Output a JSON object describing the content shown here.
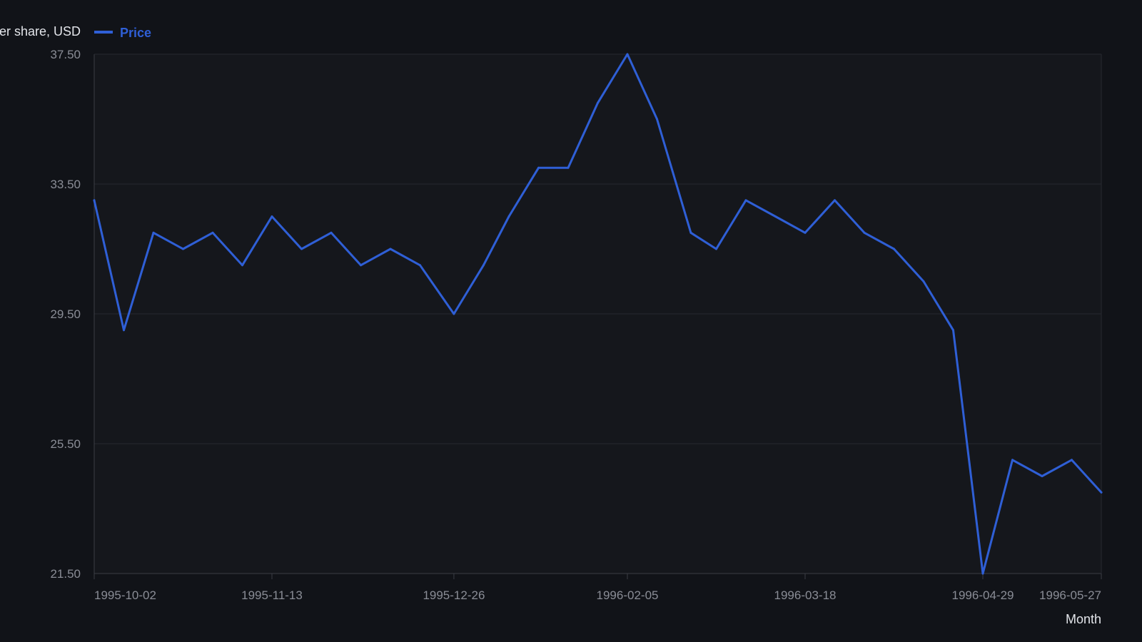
{
  "chart_data": {
    "type": "line",
    "ylabel": "Price per share, USD",
    "xlabel": "Month",
    "ylim": [
      21.5,
      37.5
    ],
    "y_ticks": [
      "21.50",
      "25.50",
      "29.50",
      "33.50",
      "37.50"
    ],
    "y_tick_values": [
      21.5,
      25.5,
      29.5,
      33.5,
      37.5
    ],
    "x_ticks": [
      "1995-10-02",
      "1995-11-13",
      "1995-12-26",
      "1996-02-05",
      "1996-03-18",
      "1996-04-29",
      "1996-05-27"
    ],
    "grid": true,
    "legend_position": "top-left",
    "series": [
      {
        "name": "Price",
        "color": "#2f5fd6",
        "points": [
          [
            "1995-10-02",
            33.0
          ],
          [
            "1995-10-09",
            29.0
          ],
          [
            "1995-10-16",
            32.0
          ],
          [
            "1995-10-23",
            31.5
          ],
          [
            "1995-10-30",
            32.0
          ],
          [
            "1995-11-06",
            31.0
          ],
          [
            "1995-11-13",
            32.5
          ],
          [
            "1995-11-20",
            31.5
          ],
          [
            "1995-11-27",
            32.0
          ],
          [
            "1995-12-04",
            31.0
          ],
          [
            "1995-12-11",
            31.5
          ],
          [
            "1995-12-18",
            31.0
          ],
          [
            "1995-12-26",
            29.5
          ],
          [
            "1996-01-02",
            31.0
          ],
          [
            "1996-01-08",
            32.5
          ],
          [
            "1996-01-15",
            34.0
          ],
          [
            "1996-01-22",
            34.0
          ],
          [
            "1996-01-29",
            36.0
          ],
          [
            "1996-02-05",
            37.5
          ],
          [
            "1996-02-12",
            35.5
          ],
          [
            "1996-02-20",
            32.0
          ],
          [
            "1996-02-26",
            31.5
          ],
          [
            "1996-03-04",
            33.0
          ],
          [
            "1996-03-11",
            32.5
          ],
          [
            "1996-03-18",
            32.0
          ],
          [
            "1996-03-25",
            33.0
          ],
          [
            "1996-04-01",
            32.0
          ],
          [
            "1996-04-08",
            31.5
          ],
          [
            "1996-04-15",
            30.5
          ],
          [
            "1996-04-22",
            29.0
          ],
          [
            "1996-04-29",
            21.5
          ],
          [
            "1996-05-06",
            25.0
          ],
          [
            "1996-05-13",
            24.5
          ],
          [
            "1996-05-20",
            25.0
          ],
          [
            "1996-05-27",
            24.0
          ]
        ]
      }
    ]
  },
  "colors": {
    "background": "#111318",
    "plot_background": "#15171c",
    "grid": "#262830",
    "axis": "#3a3d45",
    "line": "#2f5fd6",
    "tick_text": "#8a8d96",
    "title_text": "#e3e5ea"
  }
}
